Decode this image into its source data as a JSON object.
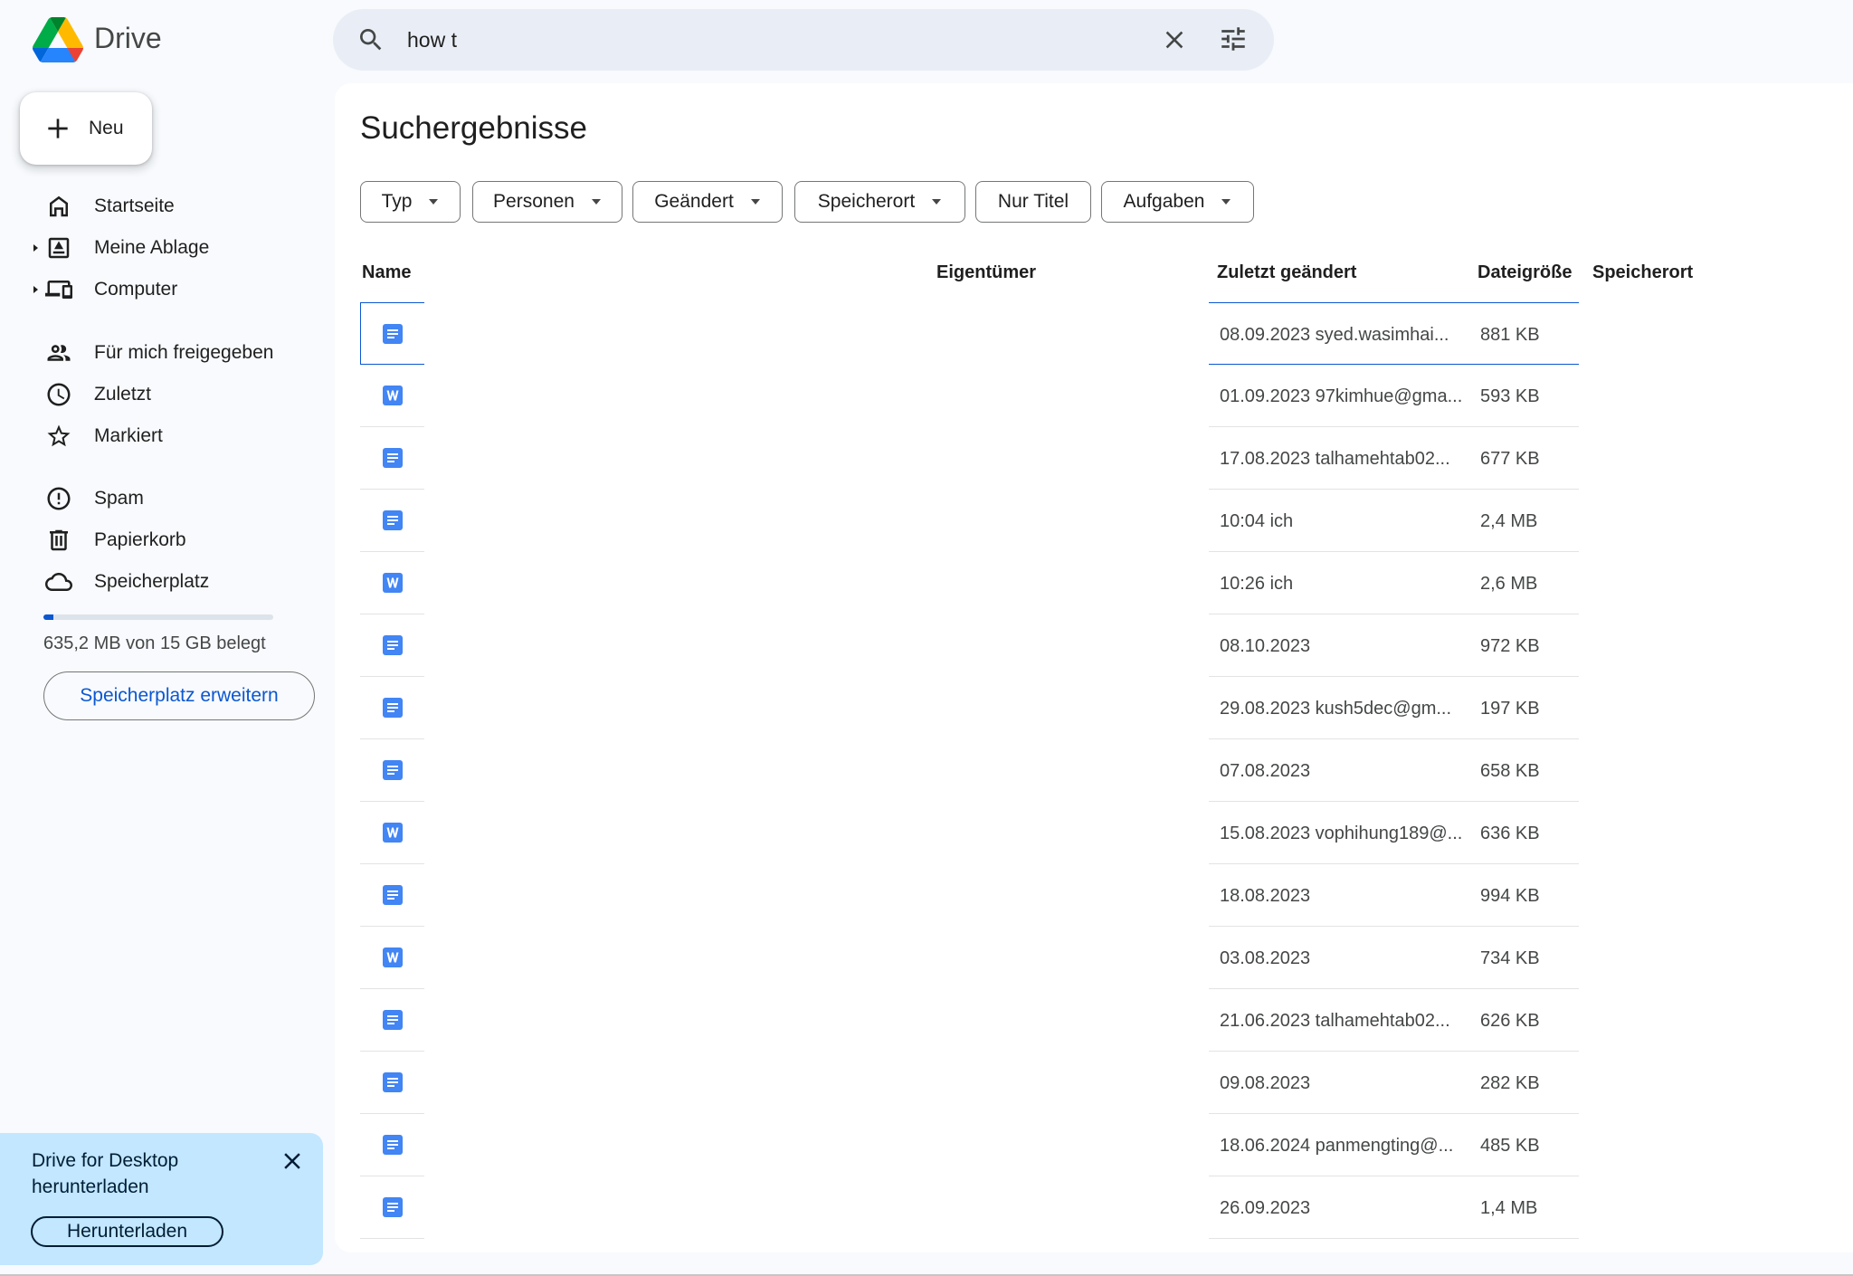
{
  "header": {
    "app_title": "Drive",
    "search_value": "how t"
  },
  "sidebar": {
    "new_label": "Neu",
    "items": [
      {
        "label": "Startseite",
        "icon": "home-icon"
      },
      {
        "label": "Meine Ablage",
        "icon": "my-drive-icon"
      },
      {
        "label": "Computer",
        "icon": "computers-icon"
      },
      {
        "label": "Für mich freigegeben",
        "icon": "shared-icon"
      },
      {
        "label": "Zuletzt",
        "icon": "clock-icon"
      },
      {
        "label": "Markiert",
        "icon": "star-icon"
      },
      {
        "label": "Spam",
        "icon": "spam-icon"
      },
      {
        "label": "Papierkorb",
        "icon": "trash-icon"
      },
      {
        "label": "Speicherplatz",
        "icon": "cloud-icon"
      }
    ],
    "storage": {
      "used_fraction": 0.042,
      "text": "635,2 MB von 15 GB belegt",
      "button": "Speicherplatz erweitern"
    },
    "promo": {
      "text": "Drive for Desktop herunterladen",
      "button": "Herunterladen"
    }
  },
  "main": {
    "title": "Suchergebnisse",
    "filters": [
      "Typ",
      "Personen",
      "Geändert",
      "Speicherort",
      "Nur Titel",
      "Aufgaben"
    ],
    "columns": {
      "name": "Name",
      "owner": "Eigentümer",
      "modified": "Zuletzt geändert",
      "size": "Dateigröße",
      "location": "Speicherort"
    },
    "files": [
      {
        "type": "docs",
        "modified": "08.09.2023 syed.wasimhai...",
        "size": "881 KB"
      },
      {
        "type": "word",
        "modified": "01.09.2023 97kimhue@gma...",
        "size": "593 KB"
      },
      {
        "type": "docs",
        "modified": "17.08.2023 talhamehtab02...",
        "size": "677 KB"
      },
      {
        "type": "docs",
        "modified": "10:04 ich",
        "size": "2,4 MB"
      },
      {
        "type": "word",
        "modified": "10:26 ich",
        "size": "2,6 MB"
      },
      {
        "type": "docs",
        "modified": "08.10.2023",
        "size": "972 KB"
      },
      {
        "type": "docs",
        "modified": "29.08.2023 kush5dec@gm...",
        "size": "197 KB"
      },
      {
        "type": "docs",
        "modified": "07.08.2023",
        "size": "658 KB"
      },
      {
        "type": "word",
        "modified": "15.08.2023 vophihung189@...",
        "size": "636 KB"
      },
      {
        "type": "docs",
        "modified": "18.08.2023",
        "size": "994 KB"
      },
      {
        "type": "word",
        "modified": "03.08.2023",
        "size": "734 KB"
      },
      {
        "type": "docs",
        "modified": "21.06.2023 talhamehtab02...",
        "size": "626 KB"
      },
      {
        "type": "docs",
        "modified": "09.08.2023",
        "size": "282 KB"
      },
      {
        "type": "docs",
        "modified": "18.06.2024 panmengting@...",
        "size": "485 KB"
      },
      {
        "type": "docs",
        "modified": "26.09.2023",
        "size": "1,4 MB"
      }
    ]
  },
  "colors": {
    "accent": "#0b57d0",
    "docs_icon": "#4285f4",
    "promo_bg": "#c2e7ff",
    "background": "#f8fafd"
  }
}
